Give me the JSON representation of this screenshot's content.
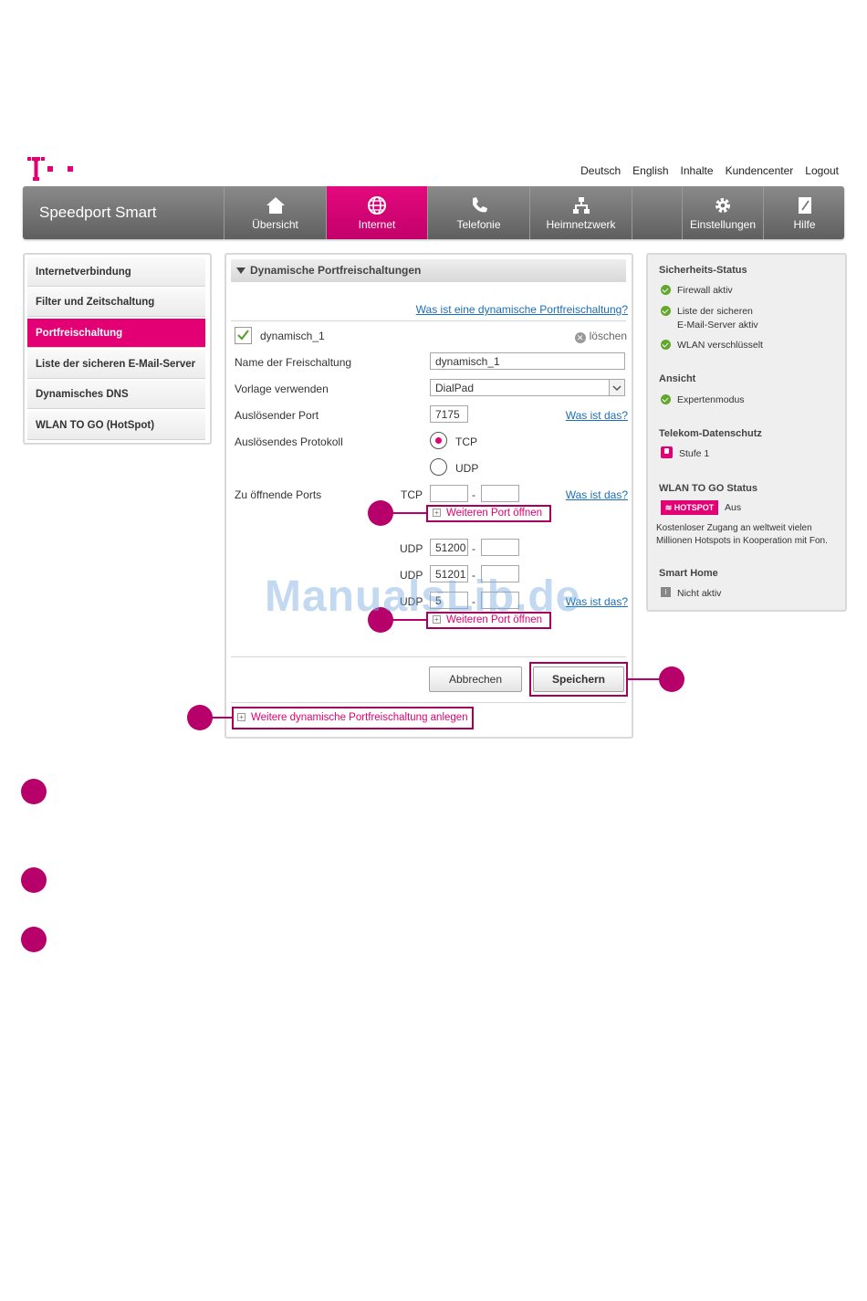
{
  "top_links": [
    "Deutsch",
    "English",
    "Inhalte",
    "Kundencenter",
    "Logout"
  ],
  "brand": "Speedport Smart",
  "nav": [
    {
      "label": "Übersicht",
      "icon": "home-icon"
    },
    {
      "label": "Internet",
      "icon": "globe-icon"
    },
    {
      "label": "Telefonie",
      "icon": "phone-icon"
    },
    {
      "label": "Heimnetzwerk",
      "icon": "network-icon"
    },
    {
      "label": "",
      "icon": ""
    },
    {
      "label": "Einstellungen",
      "icon": "gear-icon"
    },
    {
      "label": "Hilfe",
      "icon": "help-book-icon"
    }
  ],
  "left_menu": [
    "Internetverbindung",
    "Filter und Zeitschaltung",
    "Portfreischaltung",
    "Liste der sicheren E-Mail-Server",
    "Dynamisches DNS",
    "WLAN TO GO (HotSpot)"
  ],
  "main": {
    "section_title": "Dynamische Portfreischaltungen",
    "help_link": "Was ist eine dynamische Portfreischaltung?",
    "rule_name": "dynamisch_1",
    "delete_label": "löschen",
    "name_label": "Name der Freischaltung",
    "name_value": "dynamisch_1",
    "template_label": "Vorlage verwenden",
    "template_value": "DialPad",
    "trigger_port_label": "Auslösender Port",
    "trigger_port_value": "7175",
    "what_is_this": "Was ist das?",
    "trigger_protocol_label": "Auslösendes Protokoll",
    "tcp": "TCP",
    "udp": "UDP",
    "open_ports_label": "Zu öffnende Ports",
    "dash": "-",
    "add_port": "Weiteren Port öffnen",
    "udp_port_1": "51200",
    "udp_port_2": "51201",
    "udp_port_3": "5",
    "cancel": "Abbrechen",
    "save": "Speichern",
    "add_rule": "Weitere dynamische Portfreischaltung anlegen"
  },
  "status": {
    "security_title": "Sicherheits-Status",
    "firewall": "Firewall aktiv",
    "mail_list_line1": "Liste der sicheren",
    "mail_list_line2": "E-Mail-Server aktiv",
    "wlan": "WLAN verschlüsselt",
    "view_title": "Ansicht",
    "expert": "Expertenmodus",
    "privacy_title": "Telekom-Datenschutz",
    "level": "Stufe 1",
    "wlan_to_go_title": "WLAN TO GO Status",
    "hotspot_badge": "HOTSPOT",
    "hotspot_state": "Aus",
    "hotspot_desc_line1": "Kostenloser Zugang an weltweit vielen",
    "hotspot_desc_line2": "Millionen Hotspots in Kooperation mit Fon.",
    "smart_home_title": "Smart Home",
    "smart_home_state": "Nicht aktiv"
  },
  "watermark": "ManualsLib.de",
  "colors": {
    "magenta": "#e20074",
    "annotation": "#b8006a",
    "link": "#1a6fb5"
  }
}
